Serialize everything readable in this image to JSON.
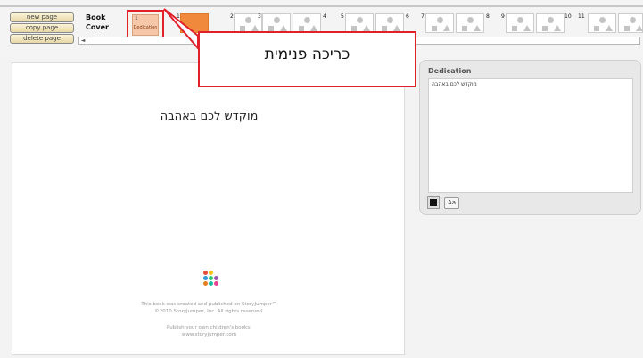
{
  "toolbar": {
    "new_page": "new page",
    "copy_page": "copy page",
    "delete_page": "delete page"
  },
  "book_cover": {
    "line1": "Book",
    "line2": "Cover"
  },
  "current_page": {
    "number": "1",
    "label": "Dedication"
  },
  "page_numbers": [
    "1",
    "2",
    "3",
    "4",
    "5",
    "6",
    "7",
    "8",
    "9",
    "10",
    "11"
  ],
  "scroll_arrow": "◄",
  "page": {
    "text": "מוקדש לכם באהבה",
    "credit_line1": "This book was created and published on StoryJumper™",
    "credit_line2": "©2010 StoryJumper, Inc.  All rights reserved.",
    "credit_line3": "Publish your own children's books:",
    "credit_line4": "www.storyjumper.com"
  },
  "panel": {
    "title": "Dedication",
    "text_value": "מוקדש לכם באהבה",
    "font_button": "Aa"
  },
  "callout": {
    "text": "כריכה פנימית"
  },
  "colors": {
    "highlight": "#e0202a",
    "accent_orange": "#f0893b",
    "logo_dots": [
      "#e74c3c",
      "#f1c40f",
      "#3498db",
      "#2ecc71",
      "#9b59b6",
      "#e67e22",
      "#1abc9c",
      "#f39c12",
      "#e84393"
    ]
  }
}
